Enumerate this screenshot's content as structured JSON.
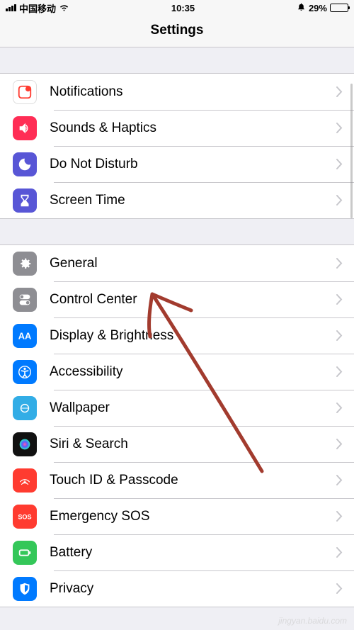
{
  "status": {
    "carrier": "中国移动",
    "time": "10:35",
    "battery_pct": "29%"
  },
  "header": {
    "title": "Settings"
  },
  "group1": [
    {
      "icon": "notifications-icon",
      "label": "Notifications"
    },
    {
      "icon": "sounds-icon",
      "label": "Sounds & Haptics"
    },
    {
      "icon": "dnd-icon",
      "label": "Do Not Disturb"
    },
    {
      "icon": "screentime-icon",
      "label": "Screen Time"
    }
  ],
  "group2": [
    {
      "icon": "general-icon",
      "label": "General"
    },
    {
      "icon": "control-center-icon",
      "label": "Control Center"
    },
    {
      "icon": "display-icon",
      "label": "Display & Brightness"
    },
    {
      "icon": "accessibility-icon",
      "label": "Accessibility"
    },
    {
      "icon": "wallpaper-icon",
      "label": "Wallpaper"
    },
    {
      "icon": "siri-icon",
      "label": "Siri & Search"
    },
    {
      "icon": "touchid-icon",
      "label": "Touch ID & Passcode"
    },
    {
      "icon": "sos-icon",
      "label": "Emergency SOS"
    },
    {
      "icon": "battery-icon",
      "label": "Battery"
    },
    {
      "icon": "privacy-icon",
      "label": "Privacy"
    }
  ],
  "watermark": "jingyan.baidu.com"
}
